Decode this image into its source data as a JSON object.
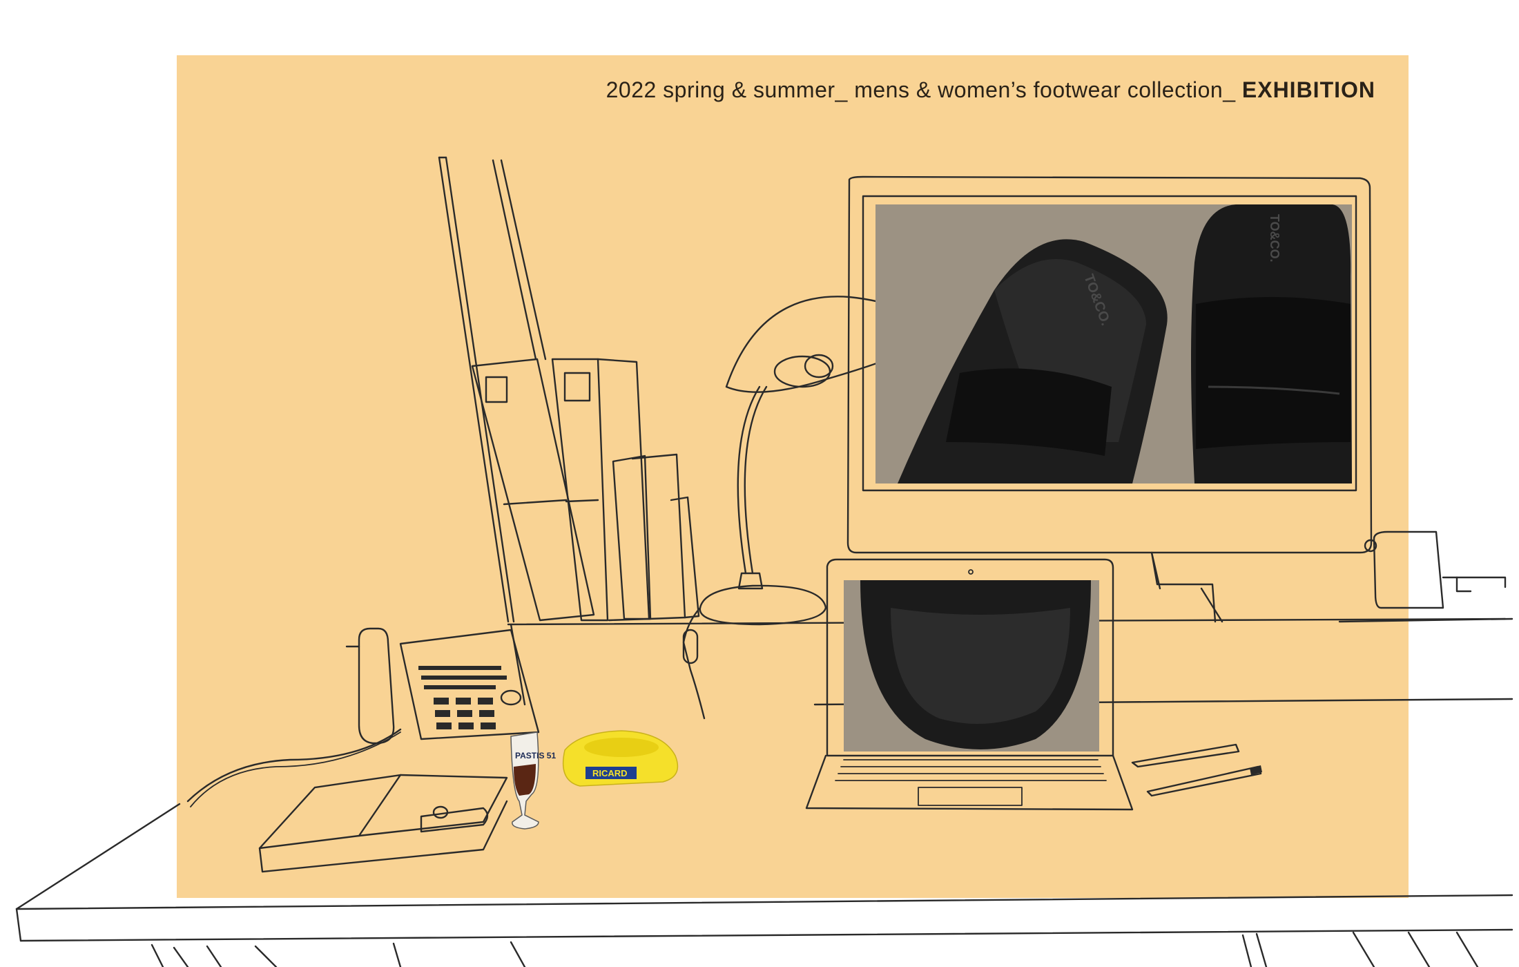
{
  "header": {
    "title_prefix": "2022 spring & summer_ mens & women’s  footwear collection_",
    "title_emphasis": "EXHIBITION"
  },
  "props": {
    "glass_label": "PASTIS 51",
    "ashtray_label": "RICARD",
    "shoe_brand_text": "TO&CO."
  },
  "colors": {
    "panel": "#f9d394",
    "background": "#ffffff",
    "line": "#2a2a2a",
    "photo_backdrop": "#9c9283",
    "ashtray_yellow": "#f5e02a"
  }
}
